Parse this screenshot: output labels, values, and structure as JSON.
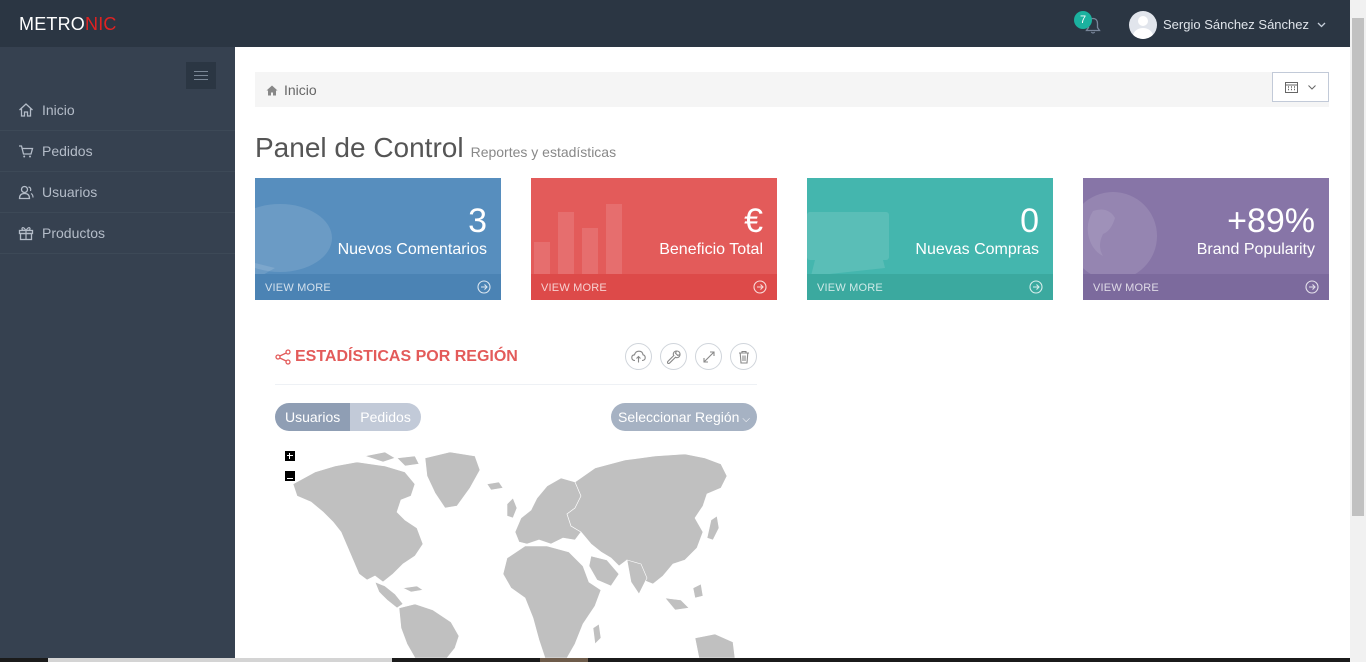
{
  "header": {
    "logo_main": "METRO",
    "logo_accent": "NIC",
    "notification_count": "7",
    "user_name": "Sergio Sánchez Sánchez"
  },
  "sidebar": {
    "items": [
      {
        "label": "Inicio",
        "icon": "home-icon"
      },
      {
        "label": "Pedidos",
        "icon": "cart-icon"
      },
      {
        "label": "Usuarios",
        "icon": "users-icon"
      },
      {
        "label": "Productos",
        "icon": "gift-icon"
      }
    ]
  },
  "breadcrumb": {
    "label": "Inicio"
  },
  "page": {
    "title": "Panel de Control",
    "subtitle": "Reportes y estadísticas"
  },
  "tiles": [
    {
      "number": "3",
      "desc": "Nuevos Comentarios",
      "more": "VIEW MORE",
      "color": "#578ebe"
    },
    {
      "number": "€",
      "desc": "Beneficio Total",
      "more": "VIEW MORE",
      "color": "#e35b5a"
    },
    {
      "number": "0",
      "desc": "Nuevas Compras",
      "more": "VIEW MORE",
      "color": "#44b6ae"
    },
    {
      "number": "+89%",
      "desc": "Brand Popularity",
      "more": "VIEW MORE",
      "color": "#8775a7"
    }
  ],
  "portlet": {
    "title": "ESTADÍSTICAS POR REGIÓN",
    "tools": [
      "cloud-upload-icon",
      "wrench-icon",
      "fullscreen-icon",
      "trash-icon"
    ],
    "toggle": [
      "Usuarios",
      "Pedidos"
    ],
    "region_select": "Seleccionar Región"
  },
  "colors": {
    "header_bg": "#2b3643",
    "sidebar_bg": "#364150",
    "accent_red": "#e35b5a",
    "map_fill": "#c0c0c0"
  }
}
